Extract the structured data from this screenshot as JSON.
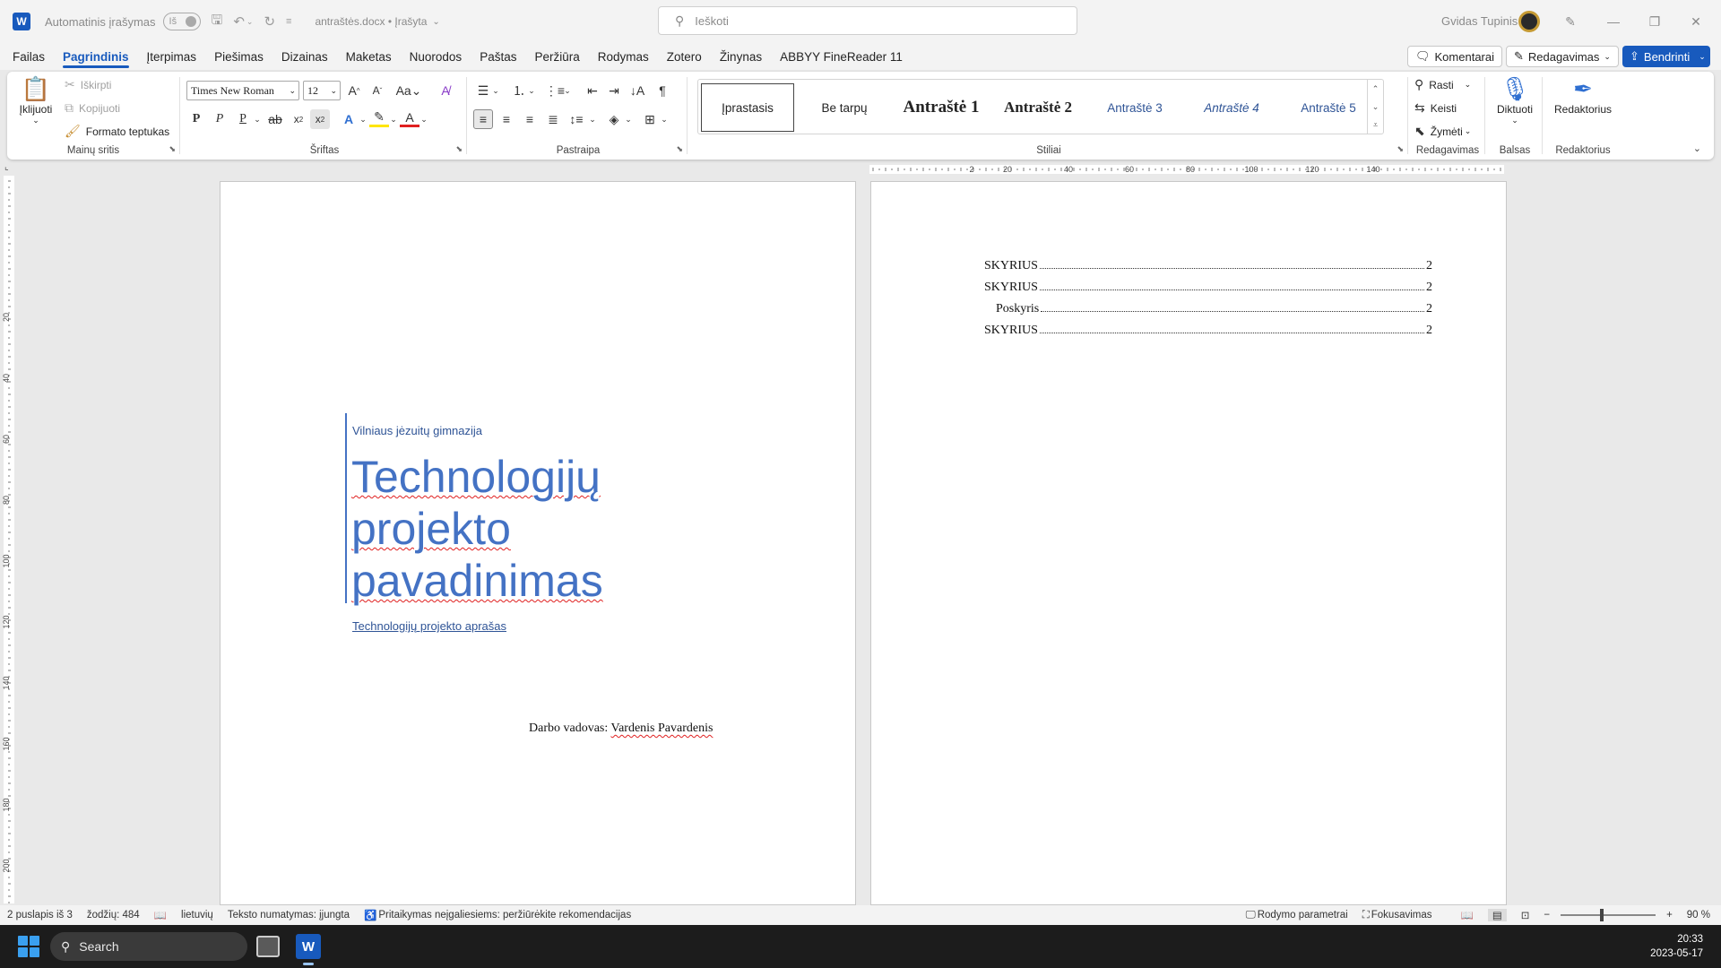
{
  "titlebar": {
    "autosave_label": "Automatinis įrašymas",
    "autosave_state": "Iš",
    "doc_title": "antraštės.docx • Įrašyta",
    "search_placeholder": "Ieškoti",
    "user_name": "Gvidas Tupinis"
  },
  "menu": {
    "tabs": [
      "Failas",
      "Pagrindinis",
      "Įterpimas",
      "Piešimas",
      "Dizainas",
      "Maketas",
      "Nuorodos",
      "Paštas",
      "Peržiūra",
      "Rodymas",
      "Zotero",
      "Žinynas",
      "ABBYY FineReader 11"
    ],
    "active_tab": "Pagrindinis",
    "comments_label": "Komentarai",
    "editing_label": "Redagavimas",
    "share_label": "Bendrinti"
  },
  "ribbon": {
    "clipboard": {
      "paste": "Įklijuoti",
      "cut": "Iškirpti",
      "copy": "Kopijuoti",
      "format_painter": "Formato teptukas",
      "label": "Mainų sritis"
    },
    "font": {
      "font_name": "Times New Roman",
      "font_size": "12",
      "bold": "P",
      "italic": "P",
      "underline": "P",
      "label": "Šriftas"
    },
    "paragraph": {
      "label": "Pastraipa"
    },
    "styles": {
      "items": [
        "Įprastasis",
        "Be tarpų",
        "Antraštė 1",
        "Antraštė 2",
        "Antraštė 3",
        "Antraštė 4",
        "Antraštė 5"
      ],
      "label": "Stiliai"
    },
    "editing": {
      "find": "Rasti",
      "replace": "Keisti",
      "select": "Žymėti",
      "label": "Redagavimas"
    },
    "voice": {
      "dictate": "Diktuoti",
      "label": "Balsas"
    },
    "editor": {
      "editor": "Redaktorius",
      "label": "Redaktorius"
    }
  },
  "ruler": {
    "h_ticks": [
      "2",
      "20",
      "40",
      "60",
      "80",
      "100",
      "120",
      "140"
    ],
    "v_ticks": [
      "20",
      "40",
      "60",
      "80",
      "100",
      "120",
      "140",
      "160",
      "180",
      "200"
    ]
  },
  "page1": {
    "school": "Vilniaus jėzuitų gimnazija",
    "title_lines": [
      "Technologijų",
      "projekto",
      "pavadinimas"
    ],
    "subtitle": "Technologijų projekto aprašas",
    "supervisor_label": "Darbo vadovas:",
    "supervisor_name": "Vardenis Pavardenis"
  },
  "page2": {
    "toc": [
      {
        "text": "SKYRIUS",
        "page": "2",
        "indent": false
      },
      {
        "text": "SKYRIUS",
        "page": "2",
        "indent": false
      },
      {
        "text": "Poskyris",
        "page": "2",
        "indent": true
      },
      {
        "text": "SKYRIUS",
        "page": "2",
        "indent": false
      }
    ]
  },
  "status": {
    "page": "2 puslapis iš 3",
    "words": "žodžių: 484",
    "language": "lietuvių",
    "prediction": "Teksto numatymas: įjungta",
    "accessibility": "Pritaikymas neįgaliesiems: peržiūrėkite rekomendacijas",
    "display_settings": "Rodymo parametrai",
    "focus": "Fokusavimas",
    "zoom": "90 %"
  },
  "taskbar": {
    "search": "Search",
    "time": "20:33",
    "date": "2023-05-17"
  },
  "colors": {
    "accent": "#185abd",
    "heading_blue": "#4472c4",
    "dark_blue": "#2f5496"
  }
}
